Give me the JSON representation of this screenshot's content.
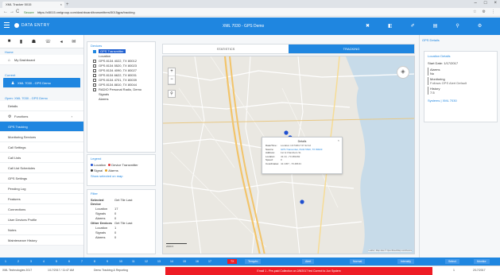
{
  "browser": {
    "tab_title": "XML Tracker 5015",
    "tab_close": "×",
    "new_tab": "+",
    "url_secure": "Secure",
    "url": "https://x5015.xmlgroup.com/dashboard/transmitters/5015gps/tracking",
    "window_controls": [
      "–",
      "□",
      "×"
    ],
    "address_icons": [
      "☆",
      "⚙",
      "⋮"
    ],
    "nav": [
      "←",
      "→",
      "C"
    ]
  },
  "header": {
    "brand": "DATA ENTRY",
    "title": "XML 7030 - GPS Demo",
    "icons": [
      "✖",
      "◧",
      "✐",
      "▤",
      "⚲",
      "⚙",
      "↦"
    ]
  },
  "sidebar": {
    "top_icons": [
      "■",
      "▮",
      "☗",
      "☏",
      "◂",
      "✉"
    ],
    "section_home": "Home",
    "dashboard": "My Dashboard",
    "section_current": "Current",
    "current_item": "XML 7030 - GPS Demo",
    "section_open": "Open: XML 7030 - GPS Demo",
    "items": [
      {
        "label": "Details",
        "active": false
      },
      {
        "label": "Functions",
        "active": false
      },
      {
        "label": "GPS Tracking",
        "active": true
      },
      {
        "label": "Monitoring Services",
        "active": false
      },
      {
        "label": "Call Settings",
        "active": false
      },
      {
        "label": "Call Lists",
        "active": false
      },
      {
        "label": "Call List Schedules",
        "active": false
      },
      {
        "label": "GPS Settings",
        "active": false
      },
      {
        "label": "Pending Log",
        "active": false
      },
      {
        "label": "Features",
        "active": false
      },
      {
        "label": "Connections",
        "active": false
      },
      {
        "label": "User Devices Profile",
        "active": false
      },
      {
        "label": "Notes",
        "active": false
      },
      {
        "label": "Maintenance History",
        "active": false
      }
    ]
  },
  "devices": {
    "title": "Devices",
    "items": [
      {
        "label": "GPS Transmitter",
        "checked": true,
        "selected": true
      },
      {
        "label": "Location",
        "checked": false,
        "selected": false
      },
      {
        "label": "GPS 8134 4022, TX 80012",
        "checked": true,
        "selected": false
      },
      {
        "label": "GPS 8134 5520, TX 80023",
        "checked": true,
        "selected": false
      },
      {
        "label": "GPS 8134 4090, TX 80027",
        "checked": true,
        "selected": false
      },
      {
        "label": "GPS 8134 6622, TX 80031",
        "checked": true,
        "selected": false
      },
      {
        "label": "GPS 8134 4701, TX 80039",
        "checked": true,
        "selected": false
      },
      {
        "label": "GPS 8134 8810, TX 80044",
        "checked": true,
        "selected": false
      },
      {
        "label": "RADIO Personal Radio, Demo",
        "checked": true,
        "selected": false
      },
      {
        "label": "Signals",
        "checked": false,
        "selected": false
      },
      {
        "label": "Alarms",
        "checked": false,
        "selected": false
      }
    ]
  },
  "legend": {
    "title": "Legend",
    "row1": [
      "Location",
      "Device Transmitter"
    ],
    "row2": [
      "Signal",
      "Alarms"
    ],
    "link": "Show selected on map",
    "colors": {
      "location": "#1f4fd0",
      "device": "#e23b3b",
      "signal": "#333333",
      "alarm": "#e0a020"
    }
  },
  "filter": {
    "title": "Filter",
    "rows": [
      [
        "Selected Device",
        "Get Tile Last"
      ],
      [
        "Location",
        "17"
      ],
      [
        "Signals",
        "0"
      ],
      [
        "Alarms",
        "0"
      ],
      [
        "Other Devices",
        "Get Tile Last"
      ],
      [
        "Location",
        "1"
      ],
      [
        "Signals",
        "0"
      ],
      [
        "Alarms",
        "0"
      ]
    ]
  },
  "tabs": {
    "statistics": "STATISTICS",
    "tracking": "TRACKING",
    "active": "tracking"
  },
  "map": {
    "zoom_in": "+",
    "zoom_out": "−",
    "search_icon": "⚲",
    "layers_icon": "◈",
    "scale_label": "2000 ft",
    "attribution": "Leaflet | Map data © OpenStreetMap contributors",
    "popup": {
      "title": "Details",
      "close": "×",
      "rows": [
        {
          "k": "Date/Time:",
          "v": "Location 1/17/2017 07:42:12",
          "link": false
        },
        {
          "k": "Source:",
          "v": "GPS Transmitter, 8134 5520, TX 80023",
          "link": true
        },
        {
          "k": "Address:",
          "v": "1st & Chambers St.",
          "link": false
        },
        {
          "k": "Location:",
          "v": "41.13, -73.481292",
          "link": false
        },
        {
          "k": "Speed:",
          "v": "0",
          "link": false
        },
        {
          "k": "Coordinates:",
          "v": "41.1307, -73.48131",
          "link": false
        }
      ]
    }
  },
  "right_panel": {
    "title": "GPS Details",
    "section1": "Location Details",
    "start_date_label": "Start Date:",
    "start_date": "1/17/2017",
    "alarm_label": "Alarms",
    "alarm_value": "No",
    "monitoring_label": "Monitoring",
    "monitoring_value": "Follows GPS Alert Default",
    "history_label": "History",
    "history_value": "7.5",
    "section2": "Systems | XML 7030"
  },
  "strip": {
    "numbers": [
      "1",
      "2",
      "3",
      "4",
      "5",
      "6",
      "7",
      "8",
      "9",
      "10",
      "11",
      "12",
      "13",
      "14",
      "15",
      "16",
      "17"
    ],
    "chips": [
      "TX",
      "Temp/m",
      "Alert",
      "Normal",
      "Intensity",
      "Select",
      "Monitor"
    ],
    "right": [
      "0",
      "8",
      "0"
    ]
  },
  "statusbar": {
    "left1": "XML Technologies 2017",
    "left2": "1/17/2017 / 11:47 AM",
    "left3": "Demo Tracking & Reporting",
    "alert": "Email 1 - Pre-paid Collection on 2/8/2017 fed Correct to Jun System",
    "right1": "1",
    "right2": "2/17/2017"
  }
}
